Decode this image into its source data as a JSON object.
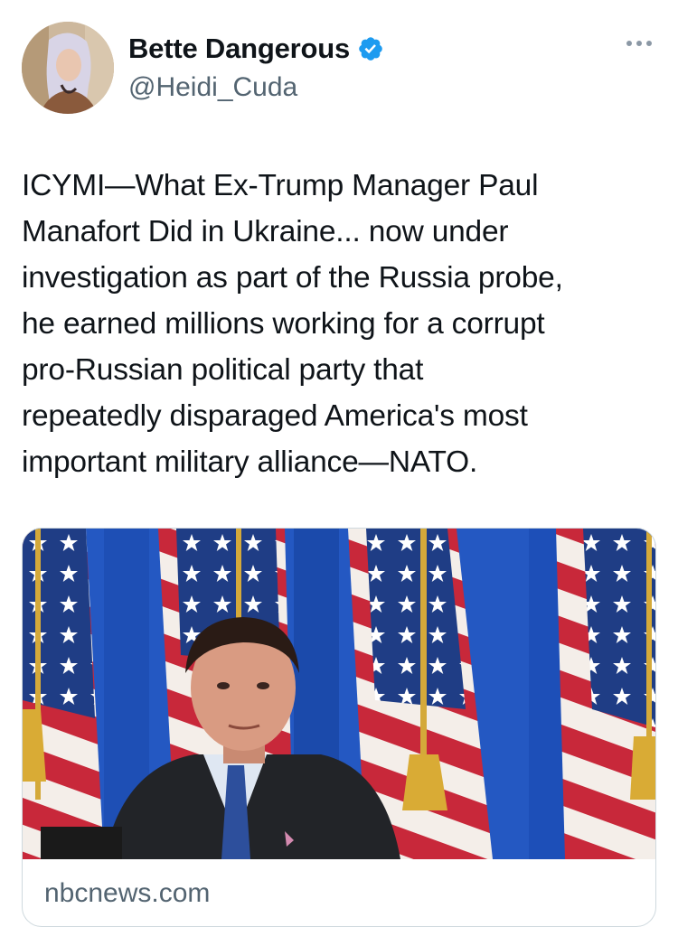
{
  "author": {
    "display_name": "Bette Dangerous",
    "handle": "@Heidi_Cuda",
    "verified": true
  },
  "tweet": {
    "text": "ICYMI—What Ex-Trump Manager Paul\nManafort Did in Ukraine... now under\ninvestigation as part of the Russia probe,\nhe earned millions working for a corrupt\npro-Russian political party that\nrepeatedly disparaged America's most\nimportant military alliance—NATO."
  },
  "link_card": {
    "domain": "nbcnews.com"
  },
  "icons": {
    "verified": "verified-badge-icon",
    "more": "more-options-icon"
  },
  "colors": {
    "verified_blue": "#1d9bf0",
    "secondary_text": "#536471",
    "primary_text": "#0f1419",
    "border": "#cfd9de"
  }
}
